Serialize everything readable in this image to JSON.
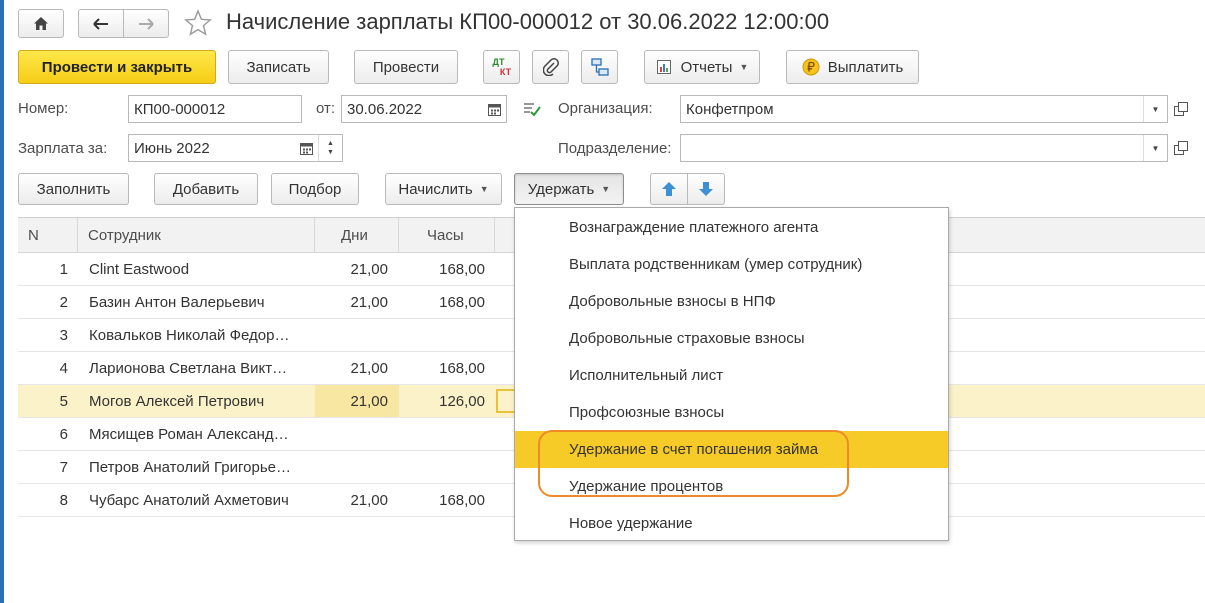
{
  "header": {
    "title": "Начисление зарплаты КП00-000012 от 30.06.2022 12:00:00"
  },
  "toolbar": {
    "post_close": "Провести и закрыть",
    "write": "Записать",
    "post": "Провести",
    "reports": "Отчеты",
    "pay": "Выплатить",
    "dtkt_top": "ДТ",
    "dtkt_bottom": "КТ"
  },
  "form": {
    "number_label": "Номер:",
    "number_value": "КП00-000012",
    "date_label": "от:",
    "date_value": "30.06.2022",
    "org_label": "Организация:",
    "org_value": "Конфетпром",
    "period_label": "Зарплата за:",
    "period_value": "Июнь 2022",
    "dept_label": "Подразделение:",
    "dept_value": ""
  },
  "table_toolbar": {
    "fill": "Заполнить",
    "add": "Добавить",
    "pick": "Подбор",
    "accrue": "Начислить",
    "deduct": "Удержать"
  },
  "table": {
    "columns": [
      "N",
      "Сотрудник",
      "Дни",
      "Часы"
    ],
    "rows": [
      {
        "n": "1",
        "name": "Clint Eastwood",
        "days": "21,00",
        "hours": "168,00"
      },
      {
        "n": "2",
        "name": "Базин Антон Валерьевич",
        "days": "21,00",
        "hours": "168,00"
      },
      {
        "n": "3",
        "name": "Ковальков Николай Федор…",
        "days": "",
        "hours": ""
      },
      {
        "n": "4",
        "name": "Ларионова Светлана Викт…",
        "days": "21,00",
        "hours": "168,00"
      },
      {
        "n": "5",
        "name": "Могов Алексей Петрович",
        "days": "21,00",
        "hours": "126,00"
      },
      {
        "n": "6",
        "name": "Мясищев Роман Александ…",
        "days": "",
        "hours": ""
      },
      {
        "n": "7",
        "name": "Петров Анатолий Григорье…",
        "days": "",
        "hours": ""
      },
      {
        "n": "8",
        "name": "Чубарс Анатолий Ахметович",
        "days": "21,00",
        "hours": "168,00"
      }
    ]
  },
  "menu": {
    "items": [
      "Вознаграждение платежного агента",
      "Выплата родственникам (умер сотрудник)",
      "Добровольные взносы в НПФ",
      "Добровольные страховые взносы",
      "Исполнительный лист",
      "Профсоюзные взносы",
      "Удержание в счет погашения займа",
      "Удержание процентов",
      "Новое удержание"
    ]
  },
  "colors": {
    "primary_button": "#f5cd16",
    "menu_highlight": "#f6ca27",
    "selected_row": "#fbf2c9",
    "annotation_outline": "#ef8a2a",
    "arrow_blue": "#3d8fd6"
  }
}
